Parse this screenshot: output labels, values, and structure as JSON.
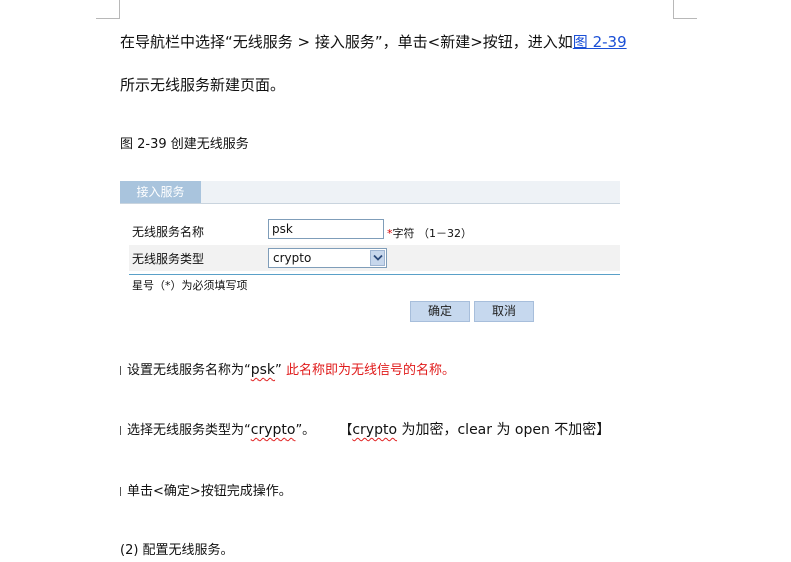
{
  "intro": {
    "line1": "在导航栏中选择“无线服务  >  接入服务”，单击<新建>按钮，进入如",
    "link": "图 2-39",
    "line2": "所示无线服务新建页面。"
  },
  "caption": "图 2-39  创建无线服务",
  "form": {
    "tab": "接入服务",
    "name_label": "无线服务名称",
    "name_value": "psk",
    "name_hint_star": "*",
    "name_hint": "字符 （1－32）",
    "type_label": "无线服务类型",
    "type_value": "crypto",
    "required_note": "星号（*）为必须填写项",
    "ok_label": "确定",
    "cancel_label": "取消"
  },
  "steps": {
    "s1_a": "设置无线服务名称为“",
    "s1_b": "psk",
    "s1_c": "”",
    "s1_red": "此名称即为无线信号的名称。",
    "s2_a": "选择无线服务类型为“",
    "s2_b": "crypto",
    "s2_c": "”。",
    "s2_note_a": "【",
    "s2_note_b": "crypto",
    "s2_note_c": " 为加密，clear 为 open 不加密】",
    "s3": "单击<确定>按钮完成操作。",
    "s4": "(2) 配置无线服务。"
  }
}
